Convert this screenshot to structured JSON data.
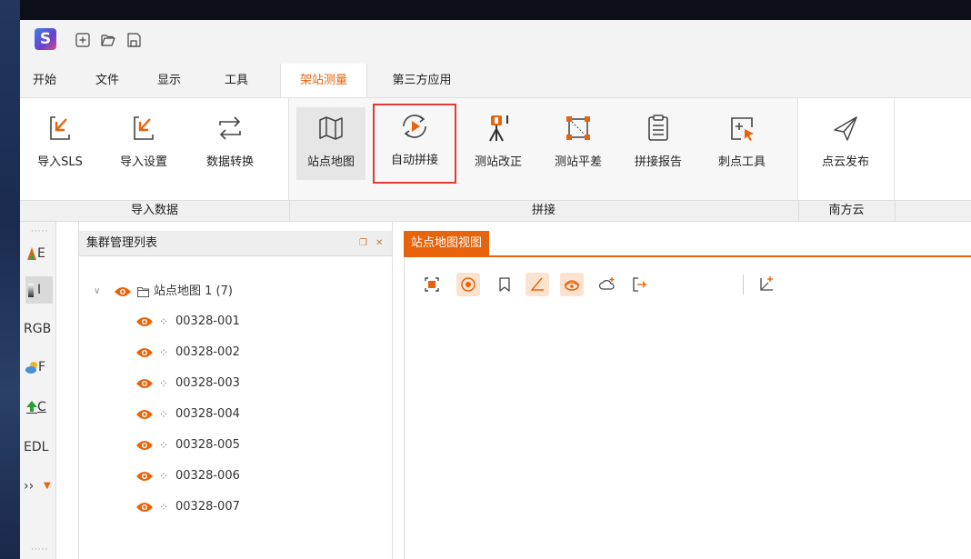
{
  "app": {
    "logo_letter": "S"
  },
  "quick_access": [
    "new-icon",
    "open-folder-icon",
    "save-icon"
  ],
  "menu": {
    "tabs": [
      "开始",
      "文件",
      "显示",
      "工具",
      "架站测量",
      "第三方应用"
    ],
    "active_tab": "架站测量"
  },
  "ribbon": {
    "buttons": {
      "import_sls": "导入SLS",
      "import_settings": "导入设置",
      "data_convert": "数据转换",
      "station_map": "站点地图",
      "auto_stitch": "自动拼接",
      "station_correct": "测站改正",
      "station_adjust": "测站平差",
      "stitch_report": "拼接报告",
      "puncture_tool": "刺点工具",
      "pointcloud_publish": "点云发布"
    },
    "groups": {
      "import_data": "导入数据",
      "stitch": "拼接",
      "south_cloud": "南方云"
    }
  },
  "leftbar": {
    "items": [
      "E",
      "I",
      "RGB",
      "F",
      "C",
      "EDL",
      "››"
    ]
  },
  "cluster_panel": {
    "title": "集群管理列表",
    "root": {
      "label": "站点地图 1 (7)"
    },
    "stations": [
      "00328-001",
      "00328-002",
      "00328-003",
      "00328-004",
      "00328-005",
      "00328-006",
      "00328-007"
    ]
  },
  "view": {
    "tab_title": "站点地图视图",
    "toolbar": [
      "fit-view-icon",
      "center-icon",
      "bookmark-icon",
      "angle-icon",
      "visibility-icon",
      "add-cloud-icon",
      "export-icon",
      "axis-add-icon"
    ]
  },
  "colors": {
    "accent": "#e8640c",
    "highlight_box": "#e53935"
  }
}
